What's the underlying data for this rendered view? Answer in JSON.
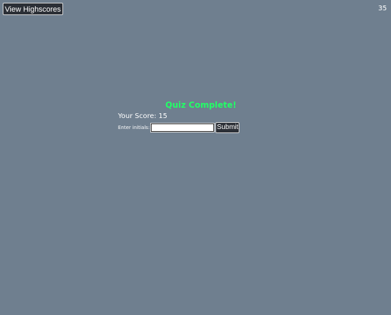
{
  "header": {
    "view_highscores_label": "View Highscores",
    "timer_value": "35"
  },
  "quiz": {
    "title": "Quiz Complete!",
    "score_label": "Your Score:",
    "score_value": "15",
    "initials_label": "Enter initials:",
    "initials_value": "",
    "submit_label": "Submit"
  },
  "colors": {
    "background": "#6f7f8f",
    "title_green": "#22ff66",
    "button_dark": "#2b2f36",
    "text_white": "#ffffff"
  }
}
